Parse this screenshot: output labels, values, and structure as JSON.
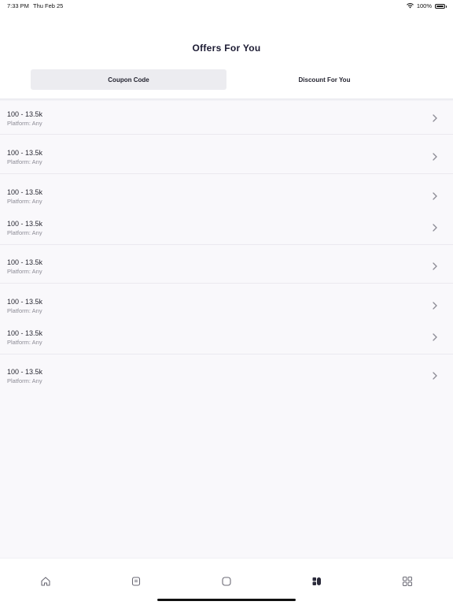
{
  "status_bar": {
    "time": "7:33 PM",
    "date": "Thu Feb 25",
    "battery": "100%"
  },
  "page_title": "Offers For You",
  "tabs": [
    {
      "label": "Coupon Code",
      "active": true
    },
    {
      "label": "Discount For You",
      "active": false
    }
  ],
  "offers": [
    {
      "amount": "100 - 13.5k",
      "platform": "Platform: Any"
    },
    {
      "amount": "100 - 13.5k",
      "platform": "Platform: Any"
    },
    {
      "amount": "100 - 13.5k",
      "platform": "Platform: Any"
    },
    {
      "amount": "100 - 13.5k",
      "platform": "Platform: Any"
    },
    {
      "amount": "100 - 13.5k",
      "platform": "Platform: Any"
    },
    {
      "amount": "100 - 13.5k",
      "platform": "Platform: Any"
    },
    {
      "amount": "100 - 13.5k",
      "platform": "Platform: Any"
    },
    {
      "amount": "100 - 13.5k",
      "platform": "Platform: Any"
    }
  ],
  "tab_bar": [
    {
      "icon": "home-icon",
      "active": false
    },
    {
      "icon": "document-icon",
      "active": false
    },
    {
      "icon": "square-icon",
      "active": false
    },
    {
      "icon": "offers-icon",
      "active": true
    },
    {
      "icon": "grid-icon",
      "active": false
    }
  ],
  "colors": {
    "title": "#1c1b33",
    "active_tab_bg": "#ececf0",
    "list_bg": "#f9f8fb",
    "secondary_text": "#8d8c96",
    "icon": "#6b6a75",
    "icon_active": "#2a2a3a"
  }
}
